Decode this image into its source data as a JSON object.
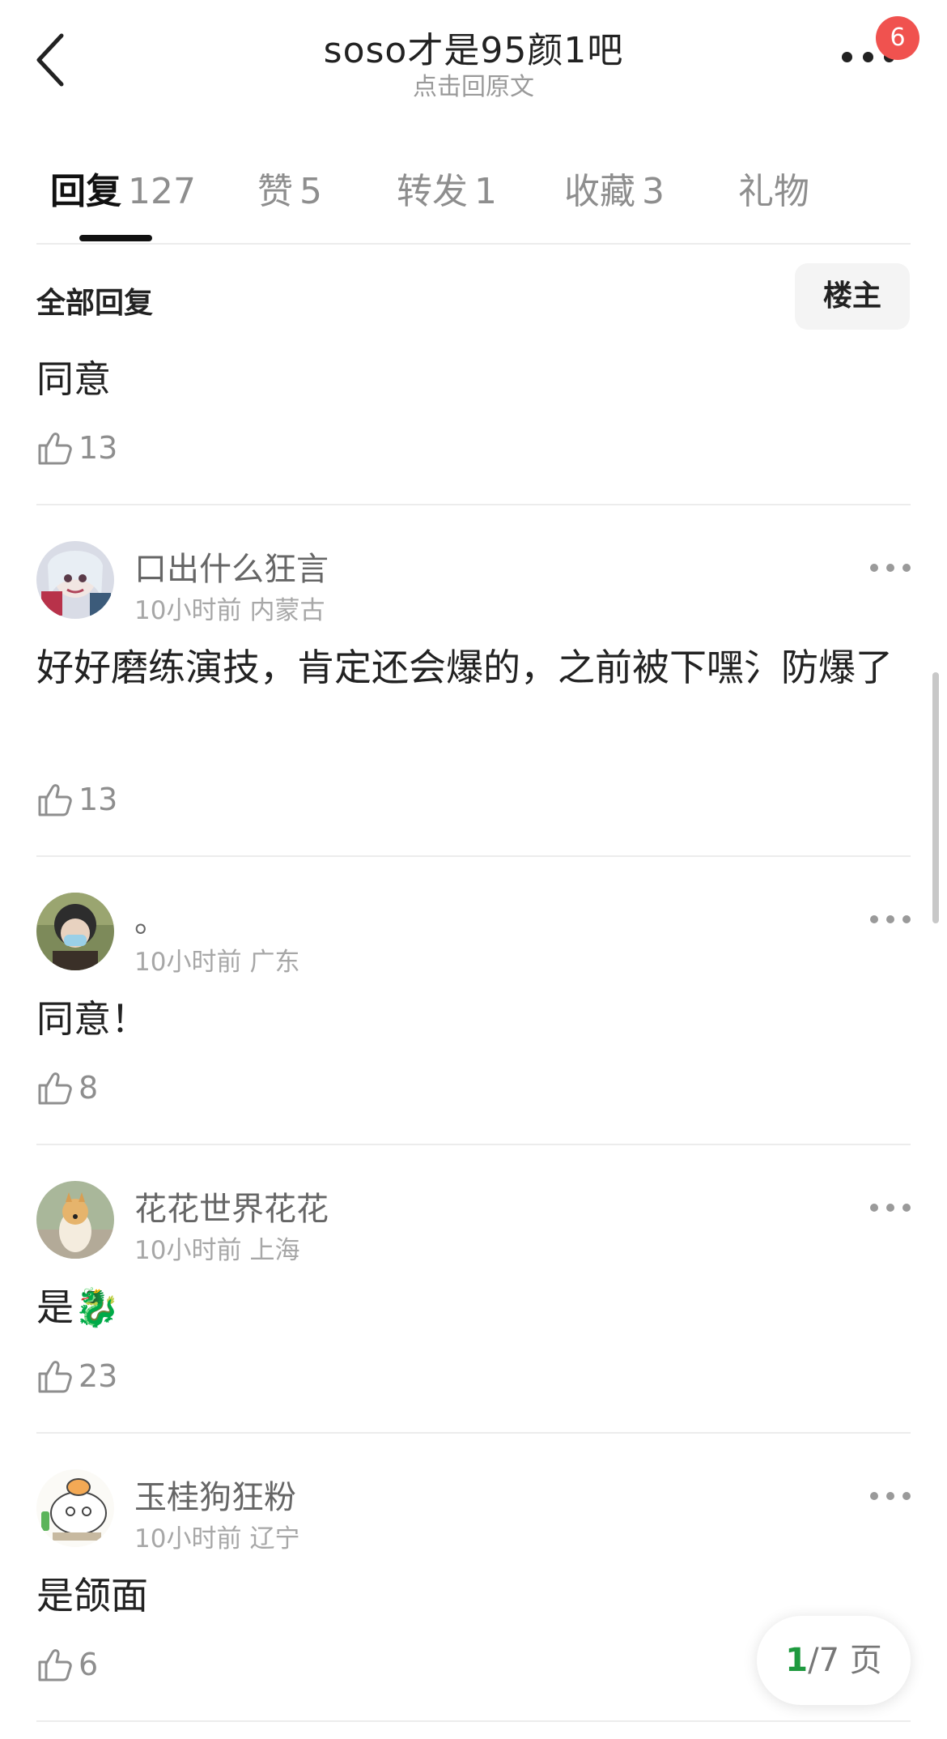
{
  "header": {
    "title": "soso才是95颜1吧",
    "subtitle": "点击回原文",
    "notification_count": "6"
  },
  "tabs": [
    {
      "label": "回复",
      "count": "127"
    },
    {
      "label": "赞",
      "count": "5"
    },
    {
      "label": "转发",
      "count": "1"
    },
    {
      "label": "收藏",
      "count": "3"
    },
    {
      "label": "礼物",
      "count": ""
    }
  ],
  "section": {
    "title": "全部回复",
    "filter_label": "楼主"
  },
  "first_reply": {
    "text": "同意",
    "likes": "13"
  },
  "comments": [
    {
      "username": "口出什么狂言",
      "time": "10小时前",
      "location": "内蒙古",
      "text": "好好磨练演技，肯定还会爆的，之前被下嘿氵防爆了",
      "likes": "13"
    },
    {
      "username": "。",
      "time": "10小时前",
      "location": "广东",
      "text": "同意！",
      "likes": "8"
    },
    {
      "username": "花花世界花花",
      "time": "10小时前",
      "location": "上海",
      "text": "是🐉",
      "likes": "23"
    },
    {
      "username": "玉桂狗狂粉",
      "time": "10小时前",
      "location": "辽宁",
      "text": "是颌面",
      "likes": "6"
    }
  ],
  "pagination": {
    "current": "1",
    "total": "/7 页"
  },
  "colors": {
    "badge": "#f0524f",
    "page_current": "#1e9a3f",
    "secondary_text": "#8e8e8e"
  },
  "icons": {
    "back": "chevron-left-icon",
    "more": "more-dots-icon",
    "like": "thumbs-up-icon"
  }
}
